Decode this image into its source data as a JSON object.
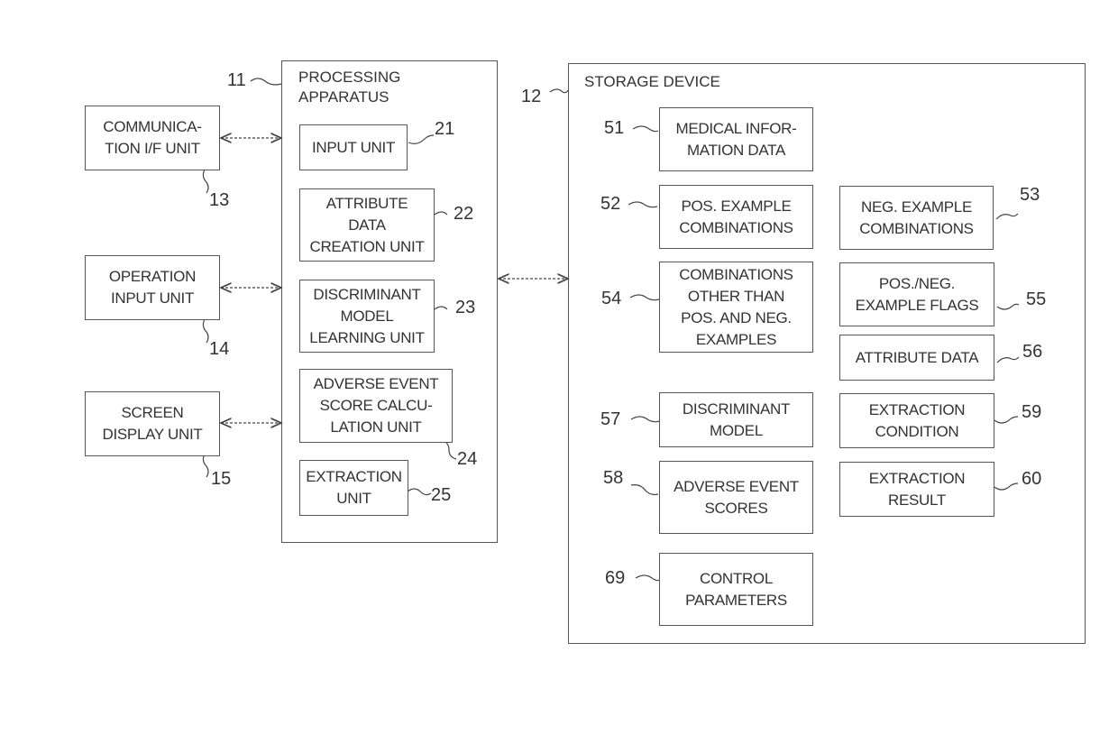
{
  "processing_apparatus": {
    "ref": "11",
    "title": "PROCESSING\nAPPARATUS",
    "units": [
      {
        "ref": "21",
        "label": "INPUT UNIT"
      },
      {
        "ref": "22",
        "label": "ATTRIBUTE\nDATA\nCREATION UNIT"
      },
      {
        "ref": "23",
        "label": "DISCRIMINANT\nMODEL\nLEARNING UNIT"
      },
      {
        "ref": "24",
        "label": "ADVERSE EVENT\nSCORE CALCU-\nLATION UNIT"
      },
      {
        "ref": "25",
        "label": "EXTRACTION\nUNIT"
      }
    ]
  },
  "external_units": [
    {
      "ref": "13",
      "label": "COMMUNICA-\nTION I/F UNIT"
    },
    {
      "ref": "14",
      "label": "OPERATION\nINPUT UNIT"
    },
    {
      "ref": "15",
      "label": "SCREEN\nDISPLAY UNIT"
    }
  ],
  "storage_device": {
    "ref": "12",
    "title": "STORAGE DEVICE",
    "items": [
      {
        "ref": "51",
        "label": "MEDICAL INFOR-\nMATION DATA"
      },
      {
        "ref": "52",
        "label": "POS. EXAMPLE\nCOMBINATIONS"
      },
      {
        "ref": "53",
        "label": "NEG. EXAMPLE\nCOMBINATIONS"
      },
      {
        "ref": "54",
        "label": "COMBINATIONS\nOTHER THAN\nPOS. AND NEG.\nEXAMPLES"
      },
      {
        "ref": "55",
        "label": "POS./NEG.\nEXAMPLE FLAGS"
      },
      {
        "ref": "56",
        "label": "ATTRIBUTE DATA"
      },
      {
        "ref": "57",
        "label": "DISCRIMINANT\nMODEL"
      },
      {
        "ref": "59",
        "label": "EXTRACTION\nCONDITION"
      },
      {
        "ref": "58",
        "label": "ADVERSE EVENT\nSCORES"
      },
      {
        "ref": "60",
        "label": "EXTRACTION\nRESULT"
      },
      {
        "ref": "69",
        "label": "CONTROL\nPARAMETERS"
      }
    ]
  }
}
